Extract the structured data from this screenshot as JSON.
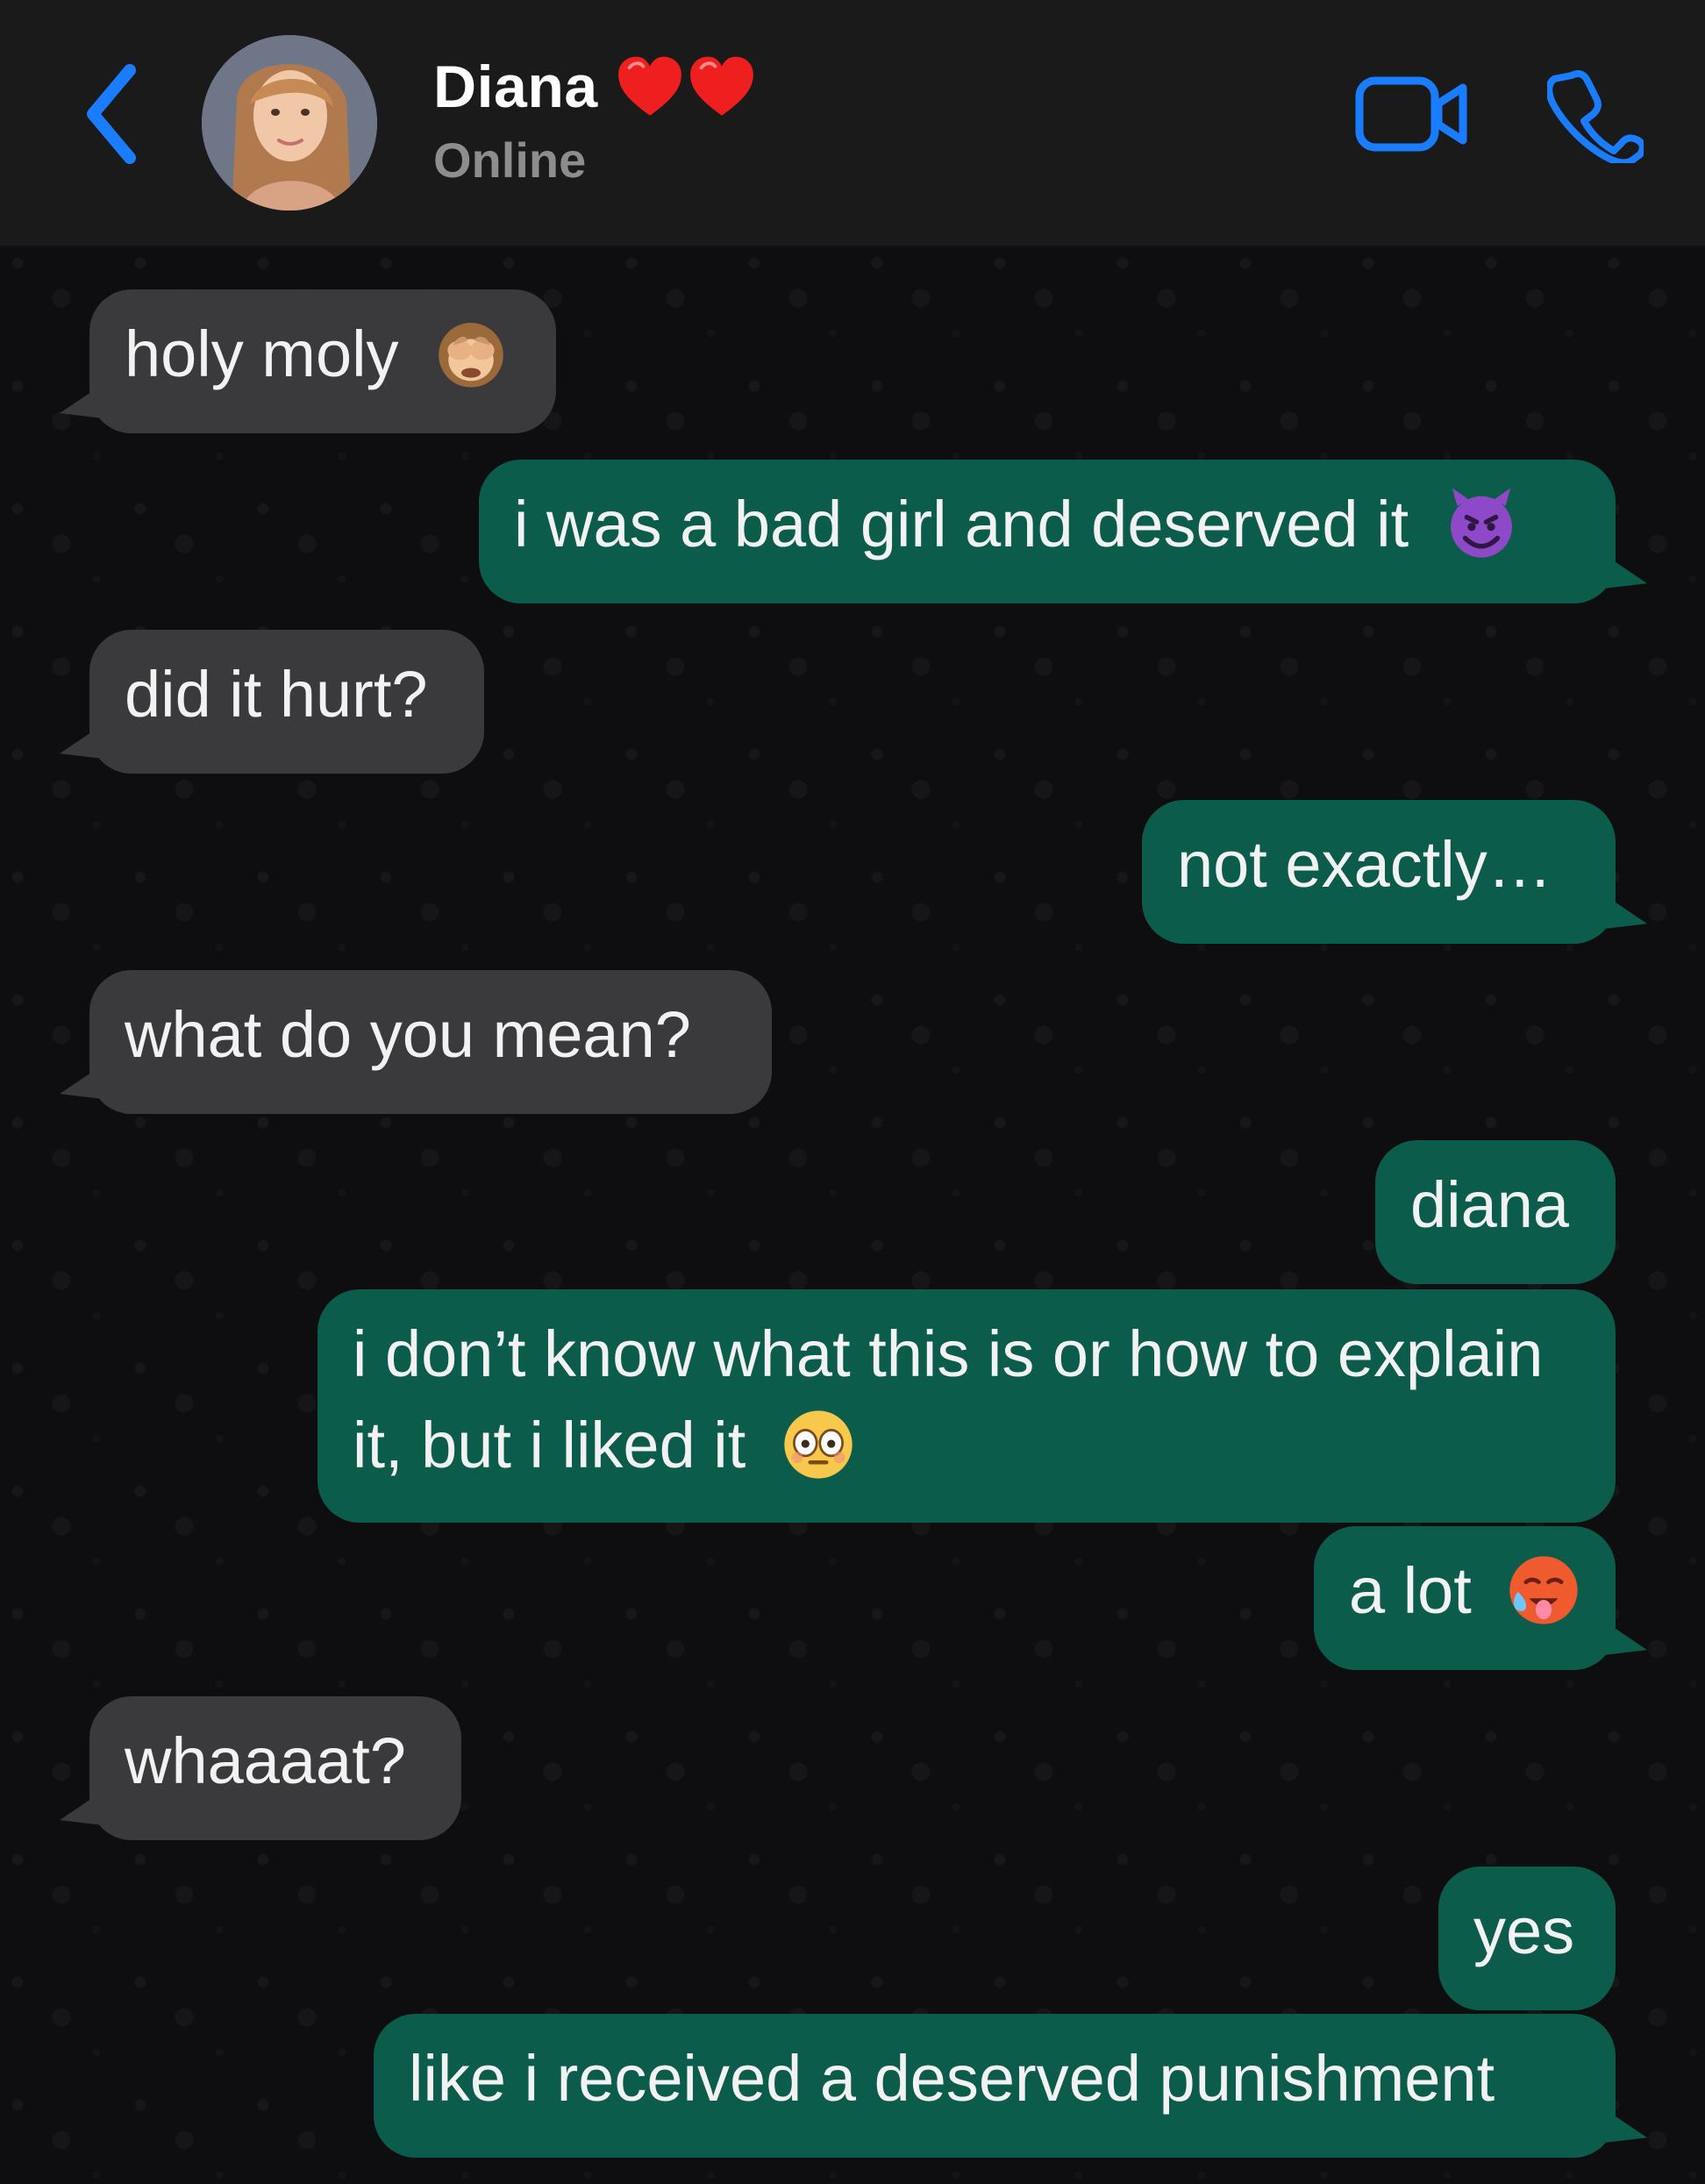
{
  "contact": {
    "name": "Diana",
    "status": "Online",
    "name_suffix_icons": [
      "heart-icon",
      "heart-icon"
    ]
  },
  "header": {
    "back_icon": "chevron-left-icon",
    "video_icon": "video-camera-icon",
    "phone_icon": "phone-icon"
  },
  "colors": {
    "header_bg": "#1a1a1b",
    "chat_bg": "#0e0e11",
    "incoming_bubble": "#3a3a3c",
    "outgoing_bubble": "#0b5c4b",
    "accent_blue": "#1a7cff",
    "status_gray": "#8d8d8d"
  },
  "messages": [
    {
      "side": "in",
      "text": "holy moly",
      "emoji": "see-no-evil-monkey-icon"
    },
    {
      "side": "out",
      "text": "i was a bad girl and deserved it",
      "emoji": "smiling-devil-icon"
    },
    {
      "side": "in",
      "text": "did it hurt?"
    },
    {
      "side": "out",
      "text": "not exactly…"
    },
    {
      "side": "in",
      "text": "what do you mean?"
    },
    {
      "side": "out",
      "text": "diana"
    },
    {
      "side": "out",
      "text": "i don’t know what this is or how to explain it, but i liked it",
      "emoji": "flushed-face-icon"
    },
    {
      "side": "out",
      "text": "a lot",
      "emoji": "hot-face-icon"
    },
    {
      "side": "in",
      "text": "whaaaat?"
    },
    {
      "side": "out",
      "text": "yes"
    },
    {
      "side": "out",
      "text": "like i received a deserved punishment"
    }
  ]
}
